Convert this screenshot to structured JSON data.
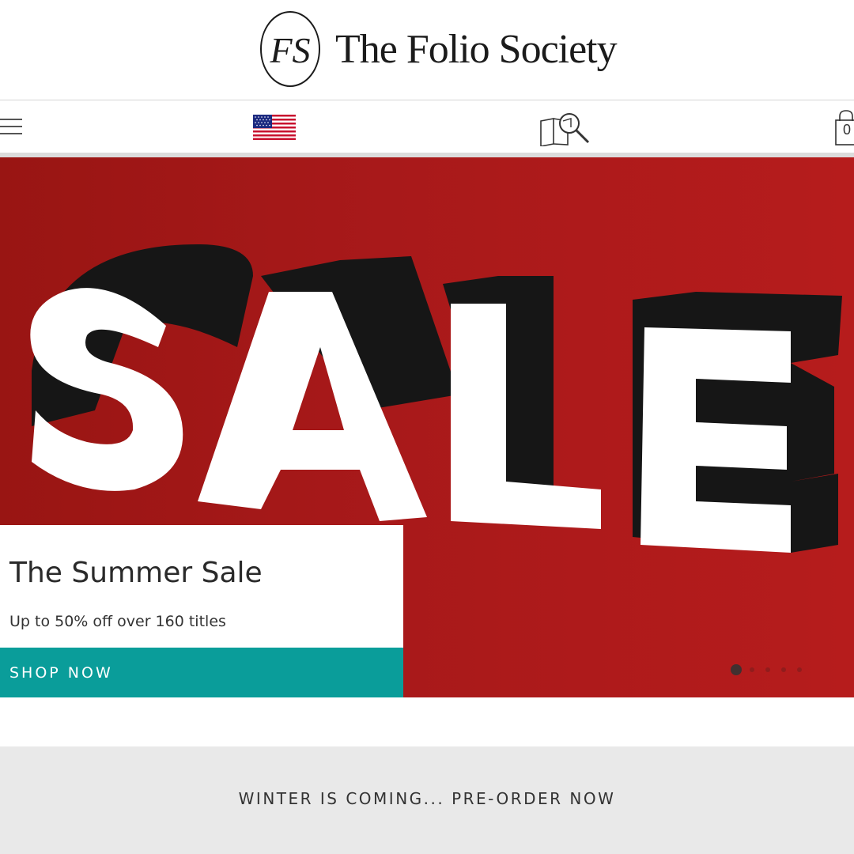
{
  "header": {
    "logo_monogram": "FS",
    "brand_name": "The Folio Society"
  },
  "toolbar": {
    "menu_icon": "hamburger-menu-icon",
    "country_icon": "us-flag-icon",
    "search_icon": "book-search-icon",
    "basket_icon": "shopping-bag-icon",
    "basket_count": "0"
  },
  "hero": {
    "image_text": "SALE",
    "title": "The Summer Sale",
    "subtitle": "Up to 50% off over 160 titles",
    "cta_label": "SHOP NOW",
    "slide_count": 5,
    "active_slide": 1
  },
  "banner": {
    "text": "WINTER IS COMING... PRE-ORDER NOW"
  },
  "colors": {
    "hero_red": "#a8191a",
    "cta_teal": "#0a9d9a",
    "banner_gray": "#e9e9e9"
  }
}
